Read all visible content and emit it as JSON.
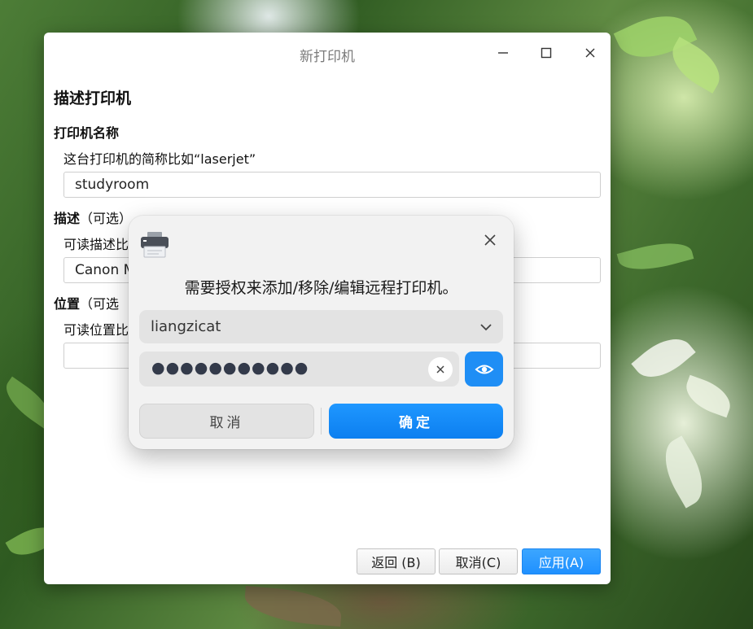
{
  "window": {
    "title": "新打印机",
    "controls": {
      "minimize_icon": "minimize-icon",
      "maximize_icon": "maximize-icon",
      "close_icon": "close-icon"
    }
  },
  "form": {
    "section_title": "描述打印机",
    "name": {
      "label": "打印机名称",
      "hint": "这台打印机的简称比如“laserjet”",
      "value": "studyroom"
    },
    "description": {
      "label": "描述",
      "optional": "（可选）",
      "hint": "可读描述比",
      "value": "Canon M"
    },
    "location": {
      "label": "位置",
      "optional": "（可选",
      "hint": "可读位置比",
      "value": ""
    }
  },
  "buttons": {
    "back": "返回 (B)",
    "cancel": "取消(C)",
    "apply": "应用(A)"
  },
  "auth_dialog": {
    "icon": "printer-icon",
    "message": "需要授权来添加/移除/编辑远程打印机。",
    "username": "liangzicat",
    "password_mask": "●●●●●●●●●●●",
    "cancel_label": "取消",
    "confirm_label": "确定"
  },
  "colors": {
    "accent": "#1f8ef5",
    "apply_button": "#2a9bff",
    "dialog_bg": "#f2f2f2"
  }
}
